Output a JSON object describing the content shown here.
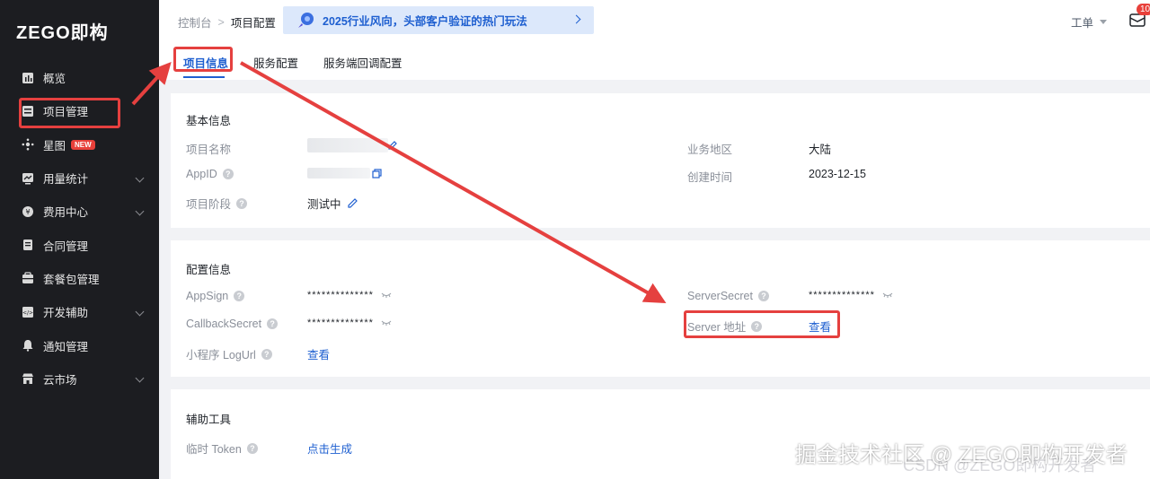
{
  "sidebar": {
    "logo": "ZEGO即构",
    "items": [
      {
        "label": "概览",
        "icon": "chart-icon",
        "chevron": false
      },
      {
        "label": "项目管理",
        "icon": "project-icon",
        "chevron": false
      },
      {
        "label": "星图",
        "icon": "star-map-icon",
        "chevron": false,
        "badge": "NEW"
      },
      {
        "label": "用量统计",
        "icon": "usage-icon",
        "chevron": true
      },
      {
        "label": "费用中心",
        "icon": "billing-icon",
        "chevron": true
      },
      {
        "label": "合同管理",
        "icon": "contract-icon",
        "chevron": false
      },
      {
        "label": "套餐包管理",
        "icon": "package-icon",
        "chevron": false
      },
      {
        "label": "开发辅助",
        "icon": "dev-icon",
        "chevron": true
      },
      {
        "label": "通知管理",
        "icon": "bell-icon",
        "chevron": false
      },
      {
        "label": "云市场",
        "icon": "market-icon",
        "chevron": true
      }
    ]
  },
  "topbar": {
    "breadcrumb": [
      "控制台",
      "项目配置"
    ],
    "banner_text": "2025行业风向，头部客户验证的热门玩法",
    "ticket_label": "工单",
    "mail_count": "10"
  },
  "tabs": [
    "项目信息",
    "服务配置",
    "服务端回调配置"
  ],
  "basic_info": {
    "title": "基本信息",
    "project_name_label": "项目名称",
    "appid_label": "AppID",
    "stage_label": "项目阶段",
    "stage_value": "测试中",
    "region_label": "业务地区",
    "region_value": "大陆",
    "created_label": "创建时间",
    "created_value": "2023-12-15"
  },
  "config_info": {
    "title": "配置信息",
    "appsign_label": "AppSign",
    "appsign_value": "**************",
    "callback_label": "CallbackSecret",
    "callback_value": "**************",
    "logurl_label": "小程序 LogUrl",
    "logurl_value": "查看",
    "serversecret_label": "ServerSecret",
    "serversecret_value": "**************",
    "server_addr_label": "Server 地址",
    "server_addr_value": "查看"
  },
  "tools": {
    "title": "辅助工具",
    "token_label": "临时 Token",
    "token_value": "点击生成"
  },
  "watermark": {
    "main": "掘金技术社区 @ ZEGO即构开发者",
    "sub": "CSDN @ZEGO即构开发者"
  },
  "colors": {
    "accent": "#1e5fd0",
    "sidebar_bg": "#1c1d21",
    "highlight": "#e5403f"
  }
}
